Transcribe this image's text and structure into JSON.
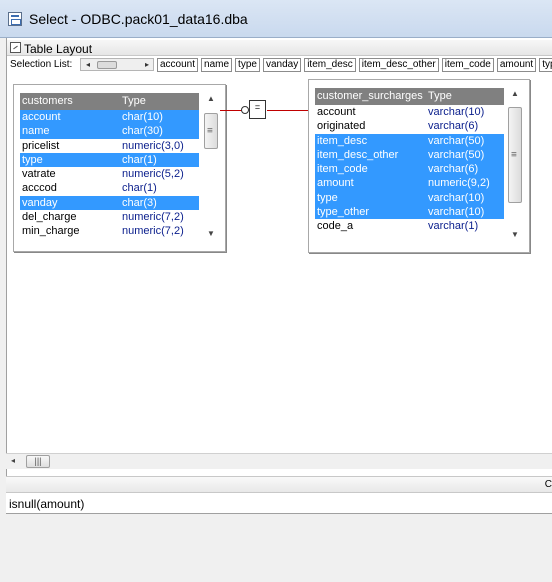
{
  "window": {
    "title": "Select - ODBC.pack01_data16.dba"
  },
  "table_layout": {
    "label": "Table Layout"
  },
  "selection_list": {
    "label": "Selection List:",
    "items": [
      "account",
      "name",
      "type",
      "vanday",
      "item_desc",
      "item_desc_other",
      "item_code",
      "amount",
      "type",
      "t"
    ]
  },
  "tables": {
    "customers": {
      "headers": [
        "customers",
        "Type"
      ],
      "rows": [
        {
          "name": "account",
          "type": "char(10)",
          "selected": true
        },
        {
          "name": "name",
          "type": "char(30)",
          "selected": true
        },
        {
          "name": "pricelist",
          "type": "numeric(3,0)",
          "selected": false
        },
        {
          "name": "type",
          "type": "char(1)",
          "selected": true
        },
        {
          "name": "vatrate",
          "type": "numeric(5,2)",
          "selected": false
        },
        {
          "name": "acccod",
          "type": "char(1)",
          "selected": false
        },
        {
          "name": "vanday",
          "type": "char(3)",
          "selected": true
        },
        {
          "name": "del_charge",
          "type": "numeric(7,2)",
          "selected": false
        },
        {
          "name": "min_charge",
          "type": "numeric(7,2)",
          "selected": false
        }
      ]
    },
    "customer_surcharges": {
      "headers": [
        "customer_surcharges",
        "Type"
      ],
      "rows": [
        {
          "name": "account",
          "type": "varchar(10)",
          "selected": false
        },
        {
          "name": "originated",
          "type": "varchar(6)",
          "selected": false
        },
        {
          "name": "item_desc",
          "type": "varchar(50)",
          "selected": true
        },
        {
          "name": "item_desc_other",
          "type": "varchar(50)",
          "selected": true
        },
        {
          "name": "item_code",
          "type": "varchar(6)",
          "selected": true
        },
        {
          "name": "amount",
          "type": "numeric(9,2)",
          "selected": true
        },
        {
          "name": "type",
          "type": "varchar(10)",
          "selected": true
        },
        {
          "name": "type_other",
          "type": "varchar(10)",
          "selected": true
        },
        {
          "name": "code_a",
          "type": "varchar(1)",
          "selected": false
        }
      ]
    }
  },
  "join": {
    "operator": "="
  },
  "bottom": {
    "tab_letter": "C",
    "expression": "isnull(amount)"
  },
  "icons": {
    "scroll_left": "◂",
    "scroll_right": "▸",
    "scroll_up": "▲",
    "scroll_down": "▼"
  },
  "colors": {
    "selection": "#3399ff",
    "header": "#808080",
    "join_line": "#c00000",
    "type_text": "#0a1e8c"
  }
}
